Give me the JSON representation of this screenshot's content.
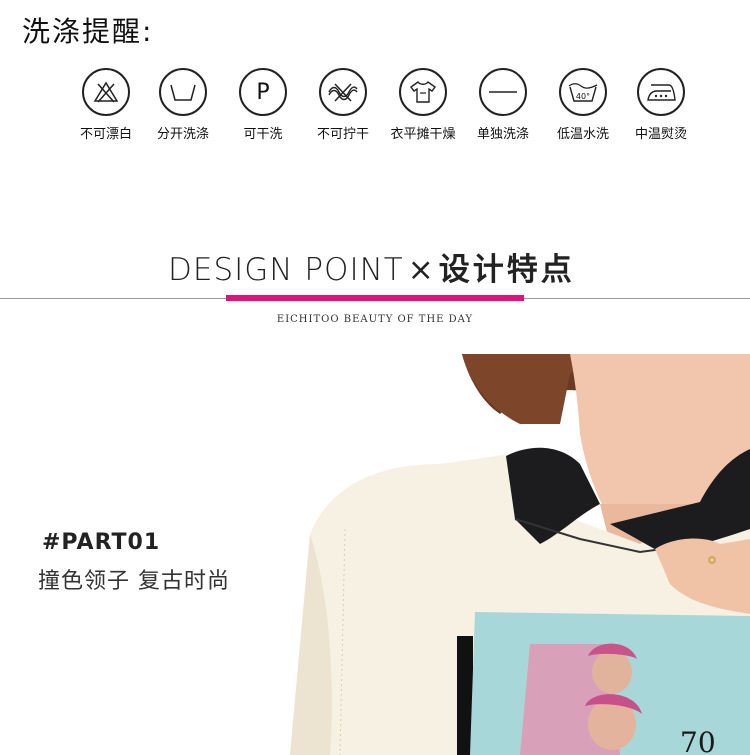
{
  "care": {
    "title": "洗涤提醒:",
    "items": [
      {
        "label": "不可漂白",
        "icon": "no-bleach-icon"
      },
      {
        "label": "分开洗涤",
        "icon": "wash-separately-icon"
      },
      {
        "label": "可干洗",
        "icon": "dry-clean-icon",
        "glyph": "P"
      },
      {
        "label": "不可拧干",
        "icon": "no-wring-icon"
      },
      {
        "label": "衣平摊干燥",
        "icon": "dry-flat-icon"
      },
      {
        "label": "单独洗涤",
        "icon": "wash-alone-icon"
      },
      {
        "label": "低温水洗",
        "icon": "low-temp-wash-icon",
        "glyph": "40°"
      },
      {
        "label": "中温熨烫",
        "icon": "medium-iron-icon"
      }
    ]
  },
  "design": {
    "title_en": "DESIGN POINT",
    "separator": "×",
    "title_cn": "设计特点",
    "tagline": "EICHITOO  BEAUTY OF THE DAY",
    "accent_color": "#e0137d"
  },
  "part": {
    "label": "#PART01",
    "description": "撞色领子  复古时尚"
  }
}
